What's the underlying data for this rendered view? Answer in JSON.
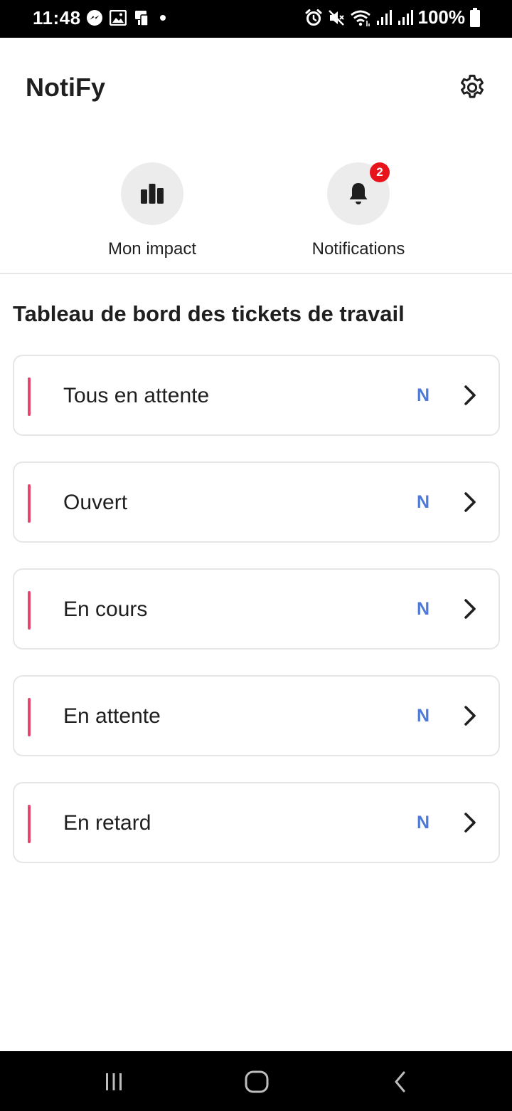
{
  "status_bar": {
    "time": "11:48",
    "battery": "100%",
    "left_icons": [
      "messenger-icon",
      "gallery-icon",
      "device-icon",
      "dot-icon"
    ],
    "right_icons": [
      "alarm-icon",
      "mute-icon",
      "wifi-icon",
      "signal-icon",
      "signal-icon",
      "battery-icon"
    ]
  },
  "header": {
    "title": "NotiFy",
    "settings_icon": "gear-icon"
  },
  "quick_actions": [
    {
      "label": "Mon impact",
      "icon": "bar-chart-icon"
    },
    {
      "label": "Notifications",
      "icon": "bell-icon",
      "badge": "2"
    }
  ],
  "dashboard": {
    "title": "Tableau de bord des tickets de travail",
    "cards": [
      {
        "label": "Tous en attente",
        "count": "N"
      },
      {
        "label": "Ouvert",
        "count": "N"
      },
      {
        "label": "En cours",
        "count": "N"
      },
      {
        "label": "En attente",
        "count": "N"
      },
      {
        "label": "En retard",
        "count": "N"
      }
    ]
  },
  "colors": {
    "accent_bar": "#e5456e",
    "count_text": "#4d79d9",
    "badge": "#e8141c",
    "circle_bg": "#ececec",
    "card_border": "#e6e6e6"
  },
  "nav_bar": {
    "buttons": [
      "recents-icon",
      "home-icon",
      "back-icon"
    ]
  }
}
